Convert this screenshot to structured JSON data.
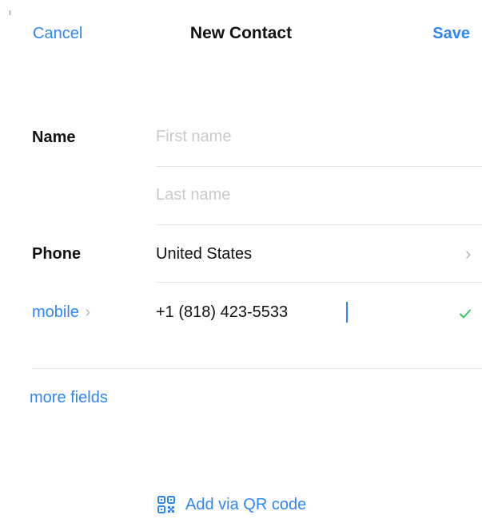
{
  "nav": {
    "cancel_label": "Cancel",
    "title": "New Contact",
    "save_label": "Save"
  },
  "name_section": {
    "label": "Name",
    "first_name_placeholder": "First name",
    "last_name_placeholder": "Last name"
  },
  "phone_section": {
    "label": "Phone",
    "country": "United States",
    "type_label": "mobile",
    "number": "+1 (818) 423-5533",
    "valid": true
  },
  "more_fields_label": "more fields",
  "qr": {
    "label": "Add via QR code",
    "icon": "qr-code-icon"
  },
  "colors": {
    "accent": "#2f86f3",
    "valid": "#34c759",
    "placeholder": "#c9c9cc",
    "separator": "#e6e6e8"
  }
}
